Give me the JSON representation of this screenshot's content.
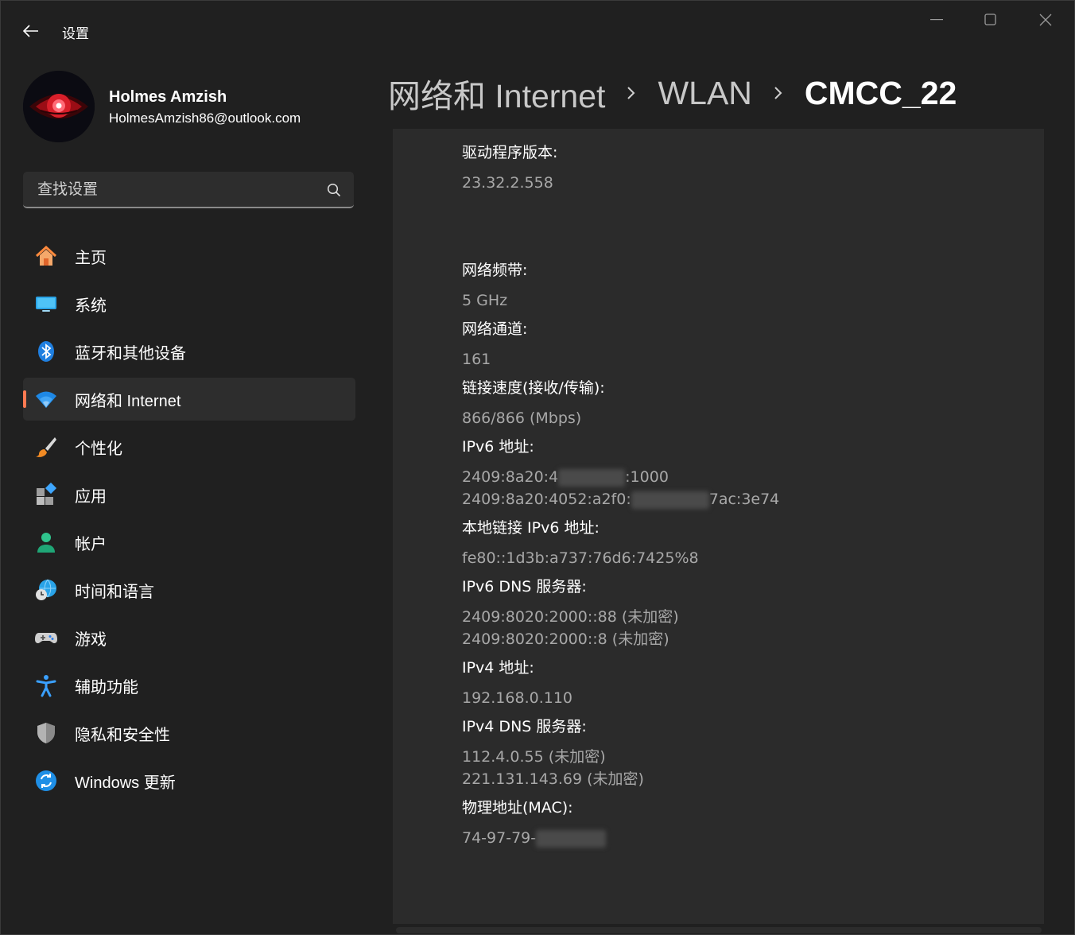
{
  "titlebar": {
    "app_title": "设置",
    "back": "back-arrow-icon"
  },
  "profile": {
    "name": "Holmes Amzish",
    "email": "HolmesAmzish86@outlook.com"
  },
  "search": {
    "placeholder": "查找设置",
    "icon": "search-icon"
  },
  "nav": {
    "items": [
      {
        "label": "主页",
        "icon": "home-icon"
      },
      {
        "label": "系统",
        "icon": "monitor-icon"
      },
      {
        "label": "蓝牙和其他设备",
        "icon": "bluetooth-icon"
      },
      {
        "label": "网络和 Internet",
        "icon": "wifi-icon",
        "active": true
      },
      {
        "label": "个性化",
        "icon": "paintbrush-icon"
      },
      {
        "label": "应用",
        "icon": "apps-icon"
      },
      {
        "label": "帐户",
        "icon": "person-icon"
      },
      {
        "label": "时间和语言",
        "icon": "globe-clock-icon"
      },
      {
        "label": "游戏",
        "icon": "gamepad-icon"
      },
      {
        "label": "辅助功能",
        "icon": "accessibility-icon"
      },
      {
        "label": "隐私和安全性",
        "icon": "shield-icon"
      },
      {
        "label": "Windows 更新",
        "icon": "refresh-icon"
      }
    ]
  },
  "breadcrumb": {
    "level1": "网络和 Internet",
    "level2": "WLAN",
    "current": "CMCC_22"
  },
  "properties": {
    "driver_version": {
      "label": "驱动程序版本:",
      "value": "23.32.2.558"
    },
    "band": {
      "label": "网络频带:",
      "value": "5 GHz"
    },
    "channel": {
      "label": "网络通道:",
      "value": "161"
    },
    "link_speed": {
      "label": "链接速度(接收/传输):",
      "value": "866/866 (Mbps)"
    },
    "ipv6": {
      "label": "IPv6 地址:",
      "value1_start": "2409:8a20:4",
      "value1_end": ":1000",
      "value2_start": "2409:8a20:4052:a2f0:",
      "value2_end": "7ac:3e74"
    },
    "link_local_ipv6": {
      "label": "本地链接 IPv6 地址:",
      "value": "fe80::1d3b:a737:76d6:7425%8"
    },
    "ipv6_dns": {
      "label": "IPv6 DNS 服务器:",
      "value1": "2409:8020:2000::88 (未加密)",
      "value2": "2409:8020:2000::8 (未加密)"
    },
    "ipv4": {
      "label": "IPv4 地址:",
      "value": "192.168.0.110"
    },
    "ipv4_dns": {
      "label": "IPv4 DNS 服务器:",
      "value1": "112.4.0.55 (未加密)",
      "value2": "221.131.143.69 (未加密)"
    },
    "mac": {
      "label": "物理地址(MAC):",
      "value_start": "74-97-79-"
    }
  },
  "colors": {
    "accent": "#ff7a52",
    "background": "#202020",
    "panel": "#2b2b2b",
    "muted_text": "#a8a8a8"
  }
}
